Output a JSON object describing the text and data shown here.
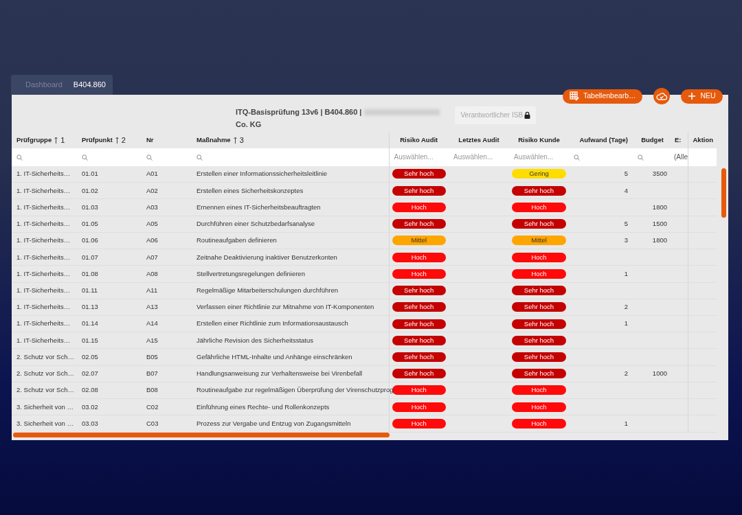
{
  "tabs": [
    {
      "label": "Dashboard",
      "selected": false
    },
    {
      "label": "B404.860",
      "selected": true
    }
  ],
  "toolbar": {
    "edit_button": "Tabellenbearb…",
    "new_button": "NEU"
  },
  "header": {
    "title_line_1": "ITQ-Basisprüfung 13v6 | B404.860 |",
    "title_line_2": "Co. KG",
    "redacted": true,
    "isb_field": {
      "placeholder": "Verantwortlicher ISB",
      "locked": true
    }
  },
  "table": {
    "columns": [
      {
        "label": "Prüfgruppe",
        "sort_rank": "1",
        "filter": {
          "kind": "search"
        }
      },
      {
        "label": "Prüfpunkt",
        "sort_rank": "2",
        "filter": {
          "kind": "search"
        }
      },
      {
        "label": "Nr",
        "filter": {
          "kind": "search"
        }
      },
      {
        "label": "Maßnahme",
        "sort_rank": "3",
        "filter": {
          "kind": "search"
        }
      },
      {
        "label": "Risiko Audit",
        "filter": {
          "kind": "select",
          "placeholder": "Auswählen..."
        }
      },
      {
        "label": "Letztes Audit",
        "filter": {
          "kind": "select",
          "placeholder": "Auswählen..."
        }
      },
      {
        "label": "Risiko Kunde",
        "filter": {
          "kind": "select",
          "placeholder": "Auswählen..."
        }
      },
      {
        "label": "Aufwand (Tage)",
        "filter": {
          "kind": "search"
        }
      },
      {
        "label": "Budget",
        "filter": {
          "kind": "search"
        }
      },
      {
        "label": "E:",
        "filter": {
          "kind": "select",
          "placeholder": "(Alle"
        }
      },
      {
        "label": "Aktion",
        "filter": {
          "kind": "none"
        }
      }
    ],
    "rows": [
      {
        "group": "1. IT-Sicherheits…",
        "point": "01.01",
        "nr": "A01",
        "measure": "Erstellen einer Informationssicherheitsleitlinie",
        "risk_audit": {
          "label": "Sehr hoch",
          "color": "#c40000"
        },
        "risk_customer": {
          "label": "Gering",
          "color": "#ffdd00"
        },
        "effort": "5",
        "budget": "3500"
      },
      {
        "group": "1. IT-Sicherheits…",
        "point": "01.02",
        "nr": "A02",
        "measure": "Erstellen eines Sicherheitskonzeptes",
        "risk_audit": {
          "label": "Sehr hoch",
          "color": "#c40000"
        },
        "risk_customer": {
          "label": "Sehr hoch",
          "color": "#c40000"
        },
        "effort": "4"
      },
      {
        "group": "1. IT-Sicherheits…",
        "point": "01.03",
        "nr": "A03",
        "measure": "Ernennen eines IT-Sicherheitsbeauftragten",
        "risk_audit": {
          "label": "Hoch",
          "color": "#ff0a0a"
        },
        "risk_customer": {
          "label": "Hoch",
          "color": "#ff0a0a"
        },
        "budget": "1800"
      },
      {
        "group": "1. IT-Sicherheits…",
        "point": "01.05",
        "nr": "A05",
        "measure": "Durchführen einer Schutzbedarfsanalyse",
        "risk_audit": {
          "label": "Sehr hoch",
          "color": "#c40000"
        },
        "risk_customer": {
          "label": "Sehr hoch",
          "color": "#c40000"
        },
        "effort": "5",
        "budget": "1500"
      },
      {
        "group": "1. IT-Sicherheits…",
        "point": "01.06",
        "nr": "A06",
        "measure": "Routineaufgaben definieren",
        "risk_audit": {
          "label": "Mittel",
          "color": "#ffa500"
        },
        "risk_customer": {
          "label": "Mittel",
          "color": "#ffa500"
        },
        "effort": "3",
        "budget": "1800"
      },
      {
        "group": "1. IT-Sicherheits…",
        "point": "01.07",
        "nr": "A07",
        "measure": "Zeitnahe Deaktivierung inaktiver Benutzerkonten",
        "risk_audit": {
          "label": "Hoch",
          "color": "#ff0a0a"
        },
        "risk_customer": {
          "label": "Hoch",
          "color": "#ff0a0a"
        }
      },
      {
        "group": "1. IT-Sicherheits…",
        "point": "01.08",
        "nr": "A08",
        "measure": "Stellvertretungsregelungen definieren",
        "risk_audit": {
          "label": "Hoch",
          "color": "#ff0a0a"
        },
        "risk_customer": {
          "label": "Hoch",
          "color": "#ff0a0a"
        },
        "effort": "1"
      },
      {
        "group": "1. IT-Sicherheits…",
        "point": "01.11",
        "nr": "A11",
        "measure": "Regelmäßige Mitarbeiterschulungen durchführen",
        "risk_audit": {
          "label": "Sehr hoch",
          "color": "#c40000"
        },
        "risk_customer": {
          "label": "Sehr hoch",
          "color": "#c40000"
        }
      },
      {
        "group": "1. IT-Sicherheits…",
        "point": "01.13",
        "nr": "A13",
        "measure": "Verfassen einer Richtlinie zur Mitnahme von IT-Komponenten",
        "risk_audit": {
          "label": "Sehr hoch",
          "color": "#c40000"
        },
        "risk_customer": {
          "label": "Sehr hoch",
          "color": "#c40000"
        },
        "effort": "2"
      },
      {
        "group": "1. IT-Sicherheits…",
        "point": "01.14",
        "nr": "A14",
        "measure": "Erstellen einer Richtlinie zum Informationsaustausch",
        "risk_audit": {
          "label": "Sehr hoch",
          "color": "#c40000"
        },
        "risk_customer": {
          "label": "Sehr hoch",
          "color": "#c40000"
        },
        "effort": "1"
      },
      {
        "group": "1. IT-Sicherheits…",
        "point": "01.15",
        "nr": "A15",
        "measure": "Jährliche Revision des Sicherheitsstatus",
        "risk_audit": {
          "label": "Sehr hoch",
          "color": "#c40000"
        },
        "risk_customer": {
          "label": "Sehr hoch",
          "color": "#c40000"
        }
      },
      {
        "group": "2. Schutz vor Sch…",
        "point": "02.05",
        "nr": "B05",
        "measure": "Gefährliche HTML-Inhalte und Anhänge einschränken",
        "risk_audit": {
          "label": "Sehr hoch",
          "color": "#c40000"
        },
        "risk_customer": {
          "label": "Sehr hoch",
          "color": "#c40000"
        }
      },
      {
        "group": "2. Schutz vor Sch…",
        "point": "02.07",
        "nr": "B07",
        "measure": "Handlungsanweisung zur Verhaltensweise bei Virenbefall",
        "risk_audit": {
          "label": "Sehr hoch",
          "color": "#c40000"
        },
        "risk_customer": {
          "label": "Sehr hoch",
          "color": "#c40000"
        },
        "effort": "2",
        "budget": "1000"
      },
      {
        "group": "2. Schutz vor Sch…",
        "point": "02.08",
        "nr": "B08",
        "measure": "Routineaufgabe zur regelmäßigen Überprüfung der Virenschutzprog",
        "risk_audit": {
          "label": "Hoch",
          "color": "#ff0a0a"
        },
        "risk_customer": {
          "label": "Hoch",
          "color": "#ff0a0a"
        }
      },
      {
        "group": "3. Sicherheit von …",
        "point": "03.02",
        "nr": "C02",
        "measure": "Einführung eines Rechte- und Rollenkonzepts",
        "risk_audit": {
          "label": "Hoch",
          "color": "#ff0a0a"
        },
        "risk_customer": {
          "label": "Hoch",
          "color": "#ff0a0a"
        }
      },
      {
        "group": "3. Sicherheit von …",
        "point": "03.03",
        "nr": "C03",
        "measure": "Prozess zur Vergabe und Entzug von Zugangsmitteln",
        "risk_audit": {
          "label": "Hoch",
          "color": "#ff0a0a"
        },
        "risk_customer": {
          "label": "Hoch",
          "color": "#ff0a0a"
        },
        "effort": "1"
      }
    ]
  }
}
